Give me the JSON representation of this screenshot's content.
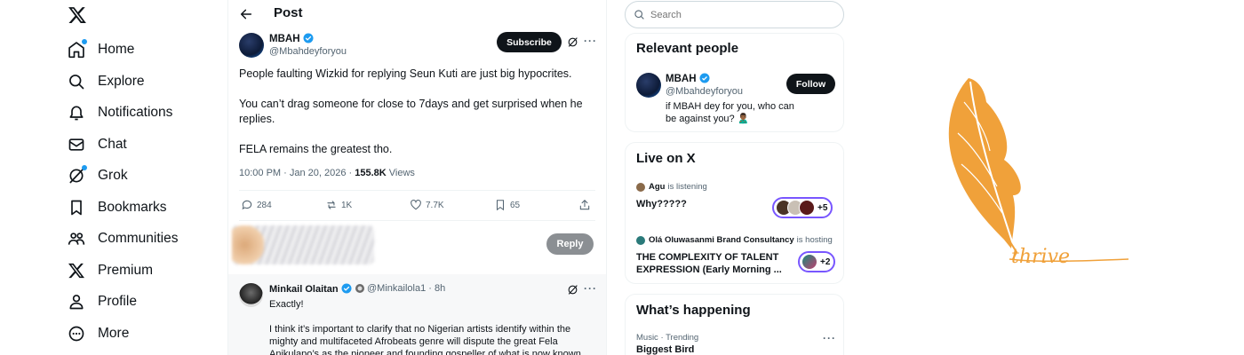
{
  "nav": {
    "items": [
      {
        "label": "Home",
        "icon": "home-icon"
      },
      {
        "label": "Explore",
        "icon": "search-icon"
      },
      {
        "label": "Notifications",
        "icon": "bell-icon"
      },
      {
        "label": "Chat",
        "icon": "mail-icon"
      },
      {
        "label": "Grok",
        "icon": "grok-icon"
      },
      {
        "label": "Bookmarks",
        "icon": "bookmark-icon"
      },
      {
        "label": "Communities",
        "icon": "communities-icon"
      },
      {
        "label": "Premium",
        "icon": "x-icon"
      },
      {
        "label": "Profile",
        "icon": "person-icon"
      },
      {
        "label": "More",
        "icon": "more-circle-icon"
      }
    ]
  },
  "post": {
    "header_title": "Post",
    "author_name": "MBAH",
    "author_handle": "@Mbahdeyforyou",
    "subscribe_label": "Subscribe",
    "text_lines": [
      "People faulting Wizkid for replying Seun Kuti are just big hypocrites.",
      "You can’t drag someone for close to 7days and get surprised when he replies.",
      "FELA remains the greatest tho."
    ],
    "meta_time": "10:00 PM · Jan 20, 2026 · ",
    "meta_views_count": "155.8K",
    "meta_views_label": " Views",
    "actions": {
      "replies": "284",
      "reposts": "1K",
      "likes": "7.7K",
      "bookmarks": "65"
    },
    "reply_button": "Reply"
  },
  "reply": {
    "name": "Minkail Olaitan",
    "handle": "@Minkailola1 · 8h",
    "line1": "Exactly!",
    "line2": "I think it’s important to clarify that no Nigerian artists identify within the mighty and multifaceted Afrobeats genre will dispute the great Fela Anikulapo’s as the pioneer and founding gospeller of what is now known"
  },
  "sidebar": {
    "search_placeholder": "Search",
    "relevant": {
      "title": "Relevant people",
      "name": "MBAH",
      "handle": "@Mbahdeyforyou",
      "bio": "if MBAH dey for you, who can be against you? 🙎🏾‍♂️",
      "follow_label": "Follow"
    },
    "live": {
      "title": "Live on X",
      "spaces": [
        {
          "host": "Agu",
          "status": "is listening",
          "title": "Why?????",
          "extra": "+5"
        },
        {
          "host": "Olá Oluwasanmi Brand Consultancy",
          "status": "is hosting",
          "title": "THE COMPLEXITY OF TALENT EXPRESSION (Early Morning ...",
          "extra": "+2"
        }
      ]
    },
    "happening": {
      "title": "What’s happening",
      "trend_meta": "Music · Trending",
      "trend_name": "Biggest Bird"
    }
  },
  "brand": {
    "wordmark": "thrive",
    "color": "#F0A13A"
  },
  "colors": {
    "accent": "#1d9bf0",
    "text": "#0f1419",
    "muted": "#536471",
    "live_border": "#7856ff"
  }
}
